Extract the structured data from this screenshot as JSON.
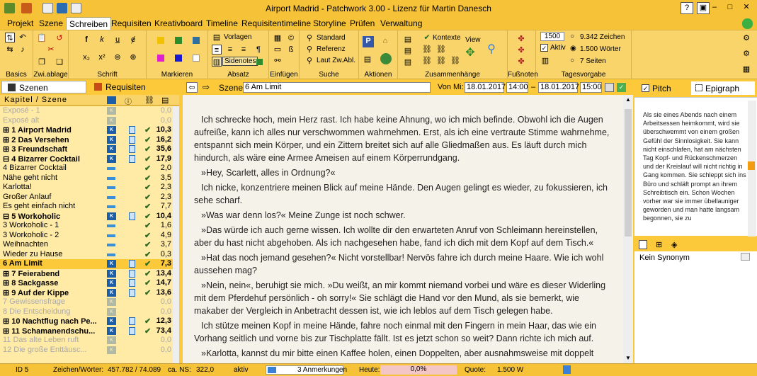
{
  "app": {
    "title": "Airport Madrid  -  Patchwork 3.00  -  Lizenz für Martin Danesch"
  },
  "menu": [
    "Projekt",
    "Szene",
    "Schreiben",
    "Requisiten",
    "Kreativboard",
    "Timeline",
    "Requisitentimeline",
    "Storyline",
    "Prüfen",
    "Verwaltung"
  ],
  "menu_active": "Schreiben",
  "ribbon": {
    "groups": {
      "basics": "Basics",
      "zwiablage": "Zwi.ablage",
      "schrift": "Schrift",
      "markieren": "Markieren",
      "absatz": "Absatz",
      "einfuegen": "Einfügen",
      "suche": "Suche",
      "aktionen": "Aktionen",
      "zusammenhaenge": "Zusammenhänge",
      "fussnoten": "Fußnoten",
      "tagesvorgabe": "Tagesvorgabe"
    },
    "vorlagen": "Vorlagen",
    "sidenotes": "Sidenotes",
    "standard": "Standard",
    "referenz": "Referenz",
    "laut": "Laut Zw.Abl.",
    "kontexte": "Kontexte",
    "view": "View",
    "goal_value": "1500",
    "aktiv": "Aktiv",
    "zeichen": "9.342 Zeichen",
    "woerter": "1.500 Wörter",
    "seiten": "7 Seiten"
  },
  "left": {
    "tab_szenen": "Szenen",
    "tab_requisiten": "Requisiten",
    "header": "Kapitel / Szene",
    "rows": [
      {
        "t": "Exposé - 1",
        "n": "0,0",
        "s": "g",
        "k": 0
      },
      {
        "t": "Exposé alt",
        "n": "0,0",
        "s": "g",
        "k": 0
      },
      {
        "t": "⊞ 1 Airport Madrid",
        "n": "10,3",
        "s": "b",
        "k": 1
      },
      {
        "t": "⊞ 2 Das Versehen",
        "n": "16,2",
        "s": "b",
        "k": 1
      },
      {
        "t": "⊞ 3 Freundschaft",
        "n": "35,6",
        "s": "b",
        "k": 1
      },
      {
        "t": "⊟ 4 Bizarrer Cocktail",
        "n": "17,9",
        "s": "b",
        "k": 1
      },
      {
        "t": "     4 Bizarrer Cocktail",
        "n": "2,0",
        "s": "",
        "k": 2
      },
      {
        "t": "     Nähe geht nicht",
        "n": "3,5",
        "s": "",
        "k": 2
      },
      {
        "t": "     Karlotta!",
        "n": "2,3",
        "s": "",
        "k": 2
      },
      {
        "t": "     Großer Anlauf",
        "n": "2,3",
        "s": "",
        "k": 2
      },
      {
        "t": "     Es geht einfach nicht",
        "n": "7,7",
        "s": "",
        "k": 2
      },
      {
        "t": "⊟ 5 Workoholic",
        "n": "10,4",
        "s": "b",
        "k": 1
      },
      {
        "t": "     3 Workoholic - 1",
        "n": "1,6",
        "s": "",
        "k": 2
      },
      {
        "t": "     3 Workoholic - 2",
        "n": "4,9",
        "s": "",
        "k": 2
      },
      {
        "t": "     Weihnachten",
        "n": "3,7",
        "s": "",
        "k": 2
      },
      {
        "t": "     Wieder zu Hause",
        "n": "0,3",
        "s": "",
        "k": 2
      },
      {
        "t": "6 Am Limit",
        "n": "7,3",
        "s": "b sel",
        "k": 1
      },
      {
        "t": "⊞ 7 Feierabend",
        "n": "13,4",
        "s": "b",
        "k": 1
      },
      {
        "t": "⊞ 8 Sackgasse",
        "n": "14,7",
        "s": "b",
        "k": 1
      },
      {
        "t": "⊞ 9 Auf der Kippe",
        "n": "13,6",
        "s": "b",
        "k": 1
      },
      {
        "t": "7 Gewissensfrage",
        "n": "0,0",
        "s": "g",
        "k": 0
      },
      {
        "t": "8 Die Entscheidung",
        "n": "0,0",
        "s": "g",
        "k": 0
      },
      {
        "t": "⊞ 10 Nachtflug nach Pe...",
        "n": "12,3",
        "s": "b",
        "k": 1
      },
      {
        "t": "⊞ 11 Schamanendschu...",
        "n": "73,4",
        "s": "b",
        "k": 1
      },
      {
        "t": "11 Das alte Leben ruft",
        "n": "0,0",
        "s": "g",
        "k": 0
      },
      {
        "t": "12 Die große Enttäusc...",
        "n": "0,0",
        "s": "g",
        "k": 0
      }
    ]
  },
  "editor": {
    "scene_label": "Szene:",
    "scene_name": "6 Am Limit",
    "von_label": "Von Mi:",
    "date_from": "18.01.2017",
    "time_from": "14:00",
    "dash": "–",
    "date_to": "18.01.2017",
    "time_to": "15:00",
    "paragraphs": [
      "Ich schrecke hoch, mein Herz rast. Ich habe keine Ahnung, wo ich mich befinde. Obwohl ich die Augen aufreiße, kann ich alles nur verschwommen wahrnehmen. Erst, als ich eine vertraute Stimme wahrnehme, entspannt sich mein Körper, und ein Zittern breitet sich auf alle Gliedmaßen aus. Es läuft durch mich hindurch, als wäre eine Armee Ameisen auf einem Körperrundgang.",
      "»Hey, Scarlett, alles in Ordnung?«",
      "Ich nicke, konzentriere meinen Blick auf meine Hände. Den Augen gelingt es wieder, zu fokussieren, ich sehe scharf.",
      "»Was war denn los?« Meine Zunge ist noch schwer.",
      "»Das würde ich auch gerne wissen. Ich wollte dir den erwarteten Anruf von Schleimann hereinstellen, aber du hast nicht abgehoben. Als ich nachgesehen habe, fand ich dich mit dem Kopf auf dem Tisch.«",
      "»Hat das noch jemand gesehen?« Nicht vorstellbar! Nervös fahre ich durch meine Haare. Wie ich wohl aussehen mag?",
      "»Nein, nein«, beruhigt sie mich. »Du weißt, an mir kommt niemand vorbei und wäre es dieser Widerling mit dem Pferdehuf persönlich - oh sorry!« Sie schlägt die Hand vor den Mund, als sie bemerkt, wie makaber der Vergleich in Anbetracht dessen ist, wie ich leblos auf dem Tisch gelegen habe.",
      "Ich stütze meinen Kopf in meine Hände, fahre noch einmal mit den Fingern in mein Haar, das wie ein Vorhang seitlich und vorne bis zur Tischplatte fällt. Ist es jetzt schon so weit? Dann richte ich mich auf.",
      "»Karlotta, kannst du mir bitte einen Kaffee holen, einen Doppelten, aber ausnahmsweise mit doppelt"
    ]
  },
  "right": {
    "tab_pitch": "Pitch",
    "tab_epigraph": "Epigraph",
    "pitch_text": "Als sie eines Abends nach einem Arbeitsessen heimkommt, wird sie überschwemmt von einem großen Gefühl der Sinnlosigkeit. Sie kann nicht einschlafen, hat am nächsten Tag Kopf- und Rückenschmerzen und der Kreislauf will nicht richtig in Gang kommen. Sie schleppt sich ins Büro und schläft prompt an ihrem Schreibtisch ein. Schon Wochen vorher war sie immer übellauniger geworden und man hatte langsam begonnen, sie zu",
    "synonym": "Kein Synonym"
  },
  "status": {
    "id": "ID 5",
    "zw_label": "Zeichen/Wörter:",
    "zw": "457.782 / 74.089",
    "ns_label": "ca. NS:",
    "ns": "322,0",
    "aktiv": "aktiv",
    "anm": "3 Anmerkungen",
    "heute_label": "Heute:",
    "heute": "0,0%",
    "quote_label": "Quote:",
    "quote": "1.500 W"
  },
  "colors": {
    "accent": "#FBC93A",
    "ribbon": "#F9D46A",
    "tree": "#FFEAA6",
    "progress": "#F4C6C6"
  }
}
